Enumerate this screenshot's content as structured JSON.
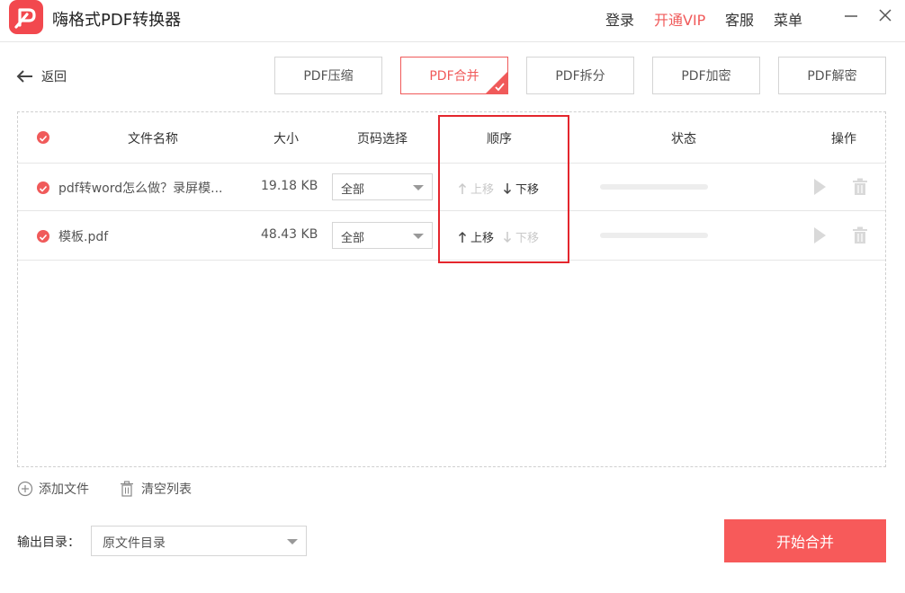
{
  "app": {
    "title": "嗨格式PDF转换器",
    "brand_color": "#f2484e"
  },
  "top_menu": {
    "login": "登录",
    "vip": "开通VIP",
    "service": "客服",
    "menu": "菜单"
  },
  "back": {
    "label": "返回"
  },
  "tabs": [
    {
      "label": "PDF压缩",
      "active": false
    },
    {
      "label": "PDF合并",
      "active": true
    },
    {
      "label": "PDF拆分",
      "active": false
    },
    {
      "label": "PDF加密",
      "active": false
    },
    {
      "label": "PDF解密",
      "active": false
    }
  ],
  "table": {
    "headers": {
      "name": "文件名称",
      "size": "大小",
      "pages": "页码选择",
      "order": "顺序",
      "status": "状态",
      "action": "操作"
    },
    "rows": [
      {
        "name": "pdf转word怎么做？录屏模...",
        "size": "19.18 KB",
        "pages": "全部",
        "up": "上移",
        "down": "下移",
        "up_enabled": false,
        "down_enabled": true
      },
      {
        "name": "模板.pdf",
        "size": "48.43 KB",
        "pages": "全部",
        "up": "上移",
        "down": "下移",
        "up_enabled": true,
        "down_enabled": false
      }
    ]
  },
  "footer": {
    "add_file": "添加文件",
    "clear_list": "清空列表",
    "output_label": "输出目录：",
    "output_value": "原文件目录",
    "start_button": "开始合并"
  }
}
